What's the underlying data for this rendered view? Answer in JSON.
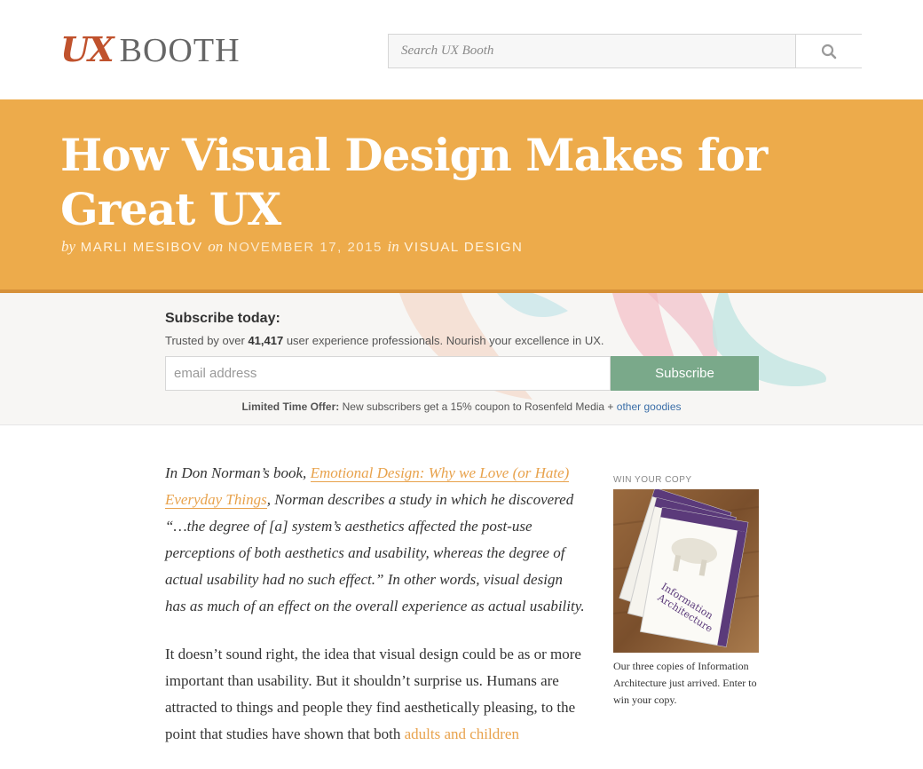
{
  "header": {
    "logo_ux": "UX",
    "logo_booth": "BOOTH",
    "search_placeholder": "Search UX Booth",
    "search_icon": "search-icon"
  },
  "hero": {
    "title": "How Visual Design Makes for Great UX",
    "by": "by",
    "author": "MARLI MESIBOV",
    "on": "on",
    "date": "NOVEMBER 17, 2015",
    "in": "in",
    "category": "VISUAL DESIGN"
  },
  "subscribe": {
    "title": "Subscribe today:",
    "desc_before": "Trusted by over ",
    "desc_count": "41,417",
    "desc_after": " user experience professionals. Nourish your excellence in UX.",
    "email_placeholder": "email address",
    "button_label": "Subscribe",
    "offer_label": "Limited Time Offer:",
    "offer_text": " New subscribers get a 15% coupon to Rosenfeld Media + ",
    "offer_link": "other goodies"
  },
  "article": {
    "intro_before": "In Don Norman’s book, ",
    "intro_link": "Emotional Design: Why we Love (or Hate) Everyday Things",
    "intro_after": ", Norman describes a study in which he discovered “…the degree of [a] system’s aesthetics affected the post-use perceptions of both aesthetics and usability, whereas the degree of actual usability had no such effect.” In other words, visual design has as much of an effect on the overall experience as actual usability.",
    "p2_text": "It doesn’t sound right, the idea that visual design could be as or more important than usability. But it shouldn’t surprise us. Humans are attracted to things and people they find aesthetically pleasing, to the point that studies have shown that both ",
    "p2_link": "adults and children"
  },
  "sidebar": {
    "label": "WIN YOUR COPY",
    "book_title_1": "Information",
    "book_title_2": "Architecture",
    "caption": "Our three copies of Information Architecture just arrived. Enter to win your copy."
  },
  "colors": {
    "hero_bg": "#edab4b",
    "logo_ux": "#c0522d",
    "subscribe_button": "#7aa98a",
    "link": "#e8a24c"
  }
}
